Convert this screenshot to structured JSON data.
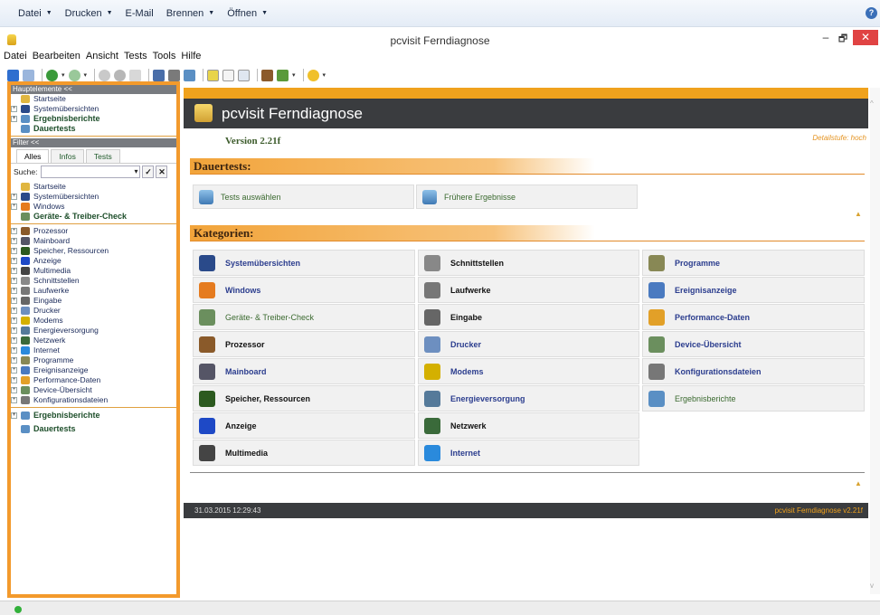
{
  "explorer_bar": {
    "items": [
      {
        "label": "Datei",
        "has_dropdown": true
      },
      {
        "label": "Drucken",
        "has_dropdown": true
      },
      {
        "label": "E-Mail",
        "has_dropdown": false
      },
      {
        "label": "Brennen",
        "has_dropdown": true
      },
      {
        "label": "Öffnen",
        "has_dropdown": true
      }
    ],
    "help_icon": "help-icon"
  },
  "window": {
    "title": "pcvisit Ferndiagnose",
    "min_glyph": "–",
    "max_glyph": "🗗",
    "close_glyph": "✕"
  },
  "menu": [
    "Datei",
    "Bearbeiten",
    "Ansicht",
    "Tests",
    "Tools",
    "Hilfe"
  ],
  "toolbar": {
    "caret": "▾"
  },
  "left": {
    "hauptelemente_header": "Hauptelemente <<",
    "haupt_items": [
      {
        "label": "Startseite",
        "expander": false,
        "bold": false,
        "icon": "computer-icon",
        "color": "#e0b640"
      },
      {
        "label": "Systemübersichten",
        "expander": true,
        "bold": false,
        "icon": "eye-icon",
        "color": "#2a4a8a"
      },
      {
        "label": "Ergebnisberichte",
        "expander": true,
        "bold": true,
        "icon": "report-icon",
        "color": "#5a8fc4"
      },
      {
        "label": "Dauertests",
        "expander": false,
        "bold": true,
        "icon": "report-icon",
        "color": "#5a8fc4"
      }
    ],
    "filter_header": "Filter <<",
    "filter_tabs": [
      "Alles",
      "Infos",
      "Tests"
    ],
    "search_label": "Suche:",
    "search_value": "",
    "search_dropdown": "▾",
    "search_apply": "✓",
    "search_clear": "✕",
    "tree_top": [
      {
        "label": "Startseite",
        "expander": false,
        "bold": false,
        "icon": "computer-icon",
        "color": "#e0b640"
      },
      {
        "label": "Systemübersichten",
        "expander": true,
        "bold": false,
        "icon": "eye-icon",
        "color": "#2a4a8a"
      },
      {
        "label": "Windows",
        "expander": true,
        "bold": false,
        "icon": "windows-icon",
        "color": "#e57b1f"
      },
      {
        "label": "Geräte- & Treiber-Check",
        "expander": false,
        "bold": true,
        "icon": "device-check-icon",
        "color": "#6b8f5e"
      }
    ],
    "tree_main": [
      {
        "label": "Prozessor",
        "icon": "processor-icon",
        "color": "#8a5a2a"
      },
      {
        "label": "Mainboard",
        "icon": "mainboard-icon",
        "color": "#556"
      },
      {
        "label": "Speicher, Ressourcen",
        "icon": "memory-icon",
        "color": "#2c5a1f"
      },
      {
        "label": "Anzeige",
        "icon": "monitor-icon",
        "color": "#1e49c6"
      },
      {
        "label": "Multimedia",
        "icon": "multimedia-icon",
        "color": "#444"
      },
      {
        "label": "Schnittstellen",
        "icon": "interface-icon",
        "color": "#888"
      },
      {
        "label": "Laufwerke",
        "icon": "drive-icon",
        "color": "#777"
      },
      {
        "label": "Eingabe",
        "icon": "keyboard-icon",
        "color": "#666"
      },
      {
        "label": "Drucker",
        "icon": "printer-icon",
        "color": "#6d8fc0"
      },
      {
        "label": "Modems",
        "icon": "modem-icon",
        "color": "#d4b000"
      },
      {
        "label": "Energieversorgung",
        "icon": "power-icon",
        "color": "#557a9a"
      },
      {
        "label": "Netzwerk",
        "icon": "network-icon",
        "color": "#3a6a3a"
      },
      {
        "label": "Internet",
        "icon": "internet-icon",
        "color": "#2a8adc"
      },
      {
        "label": "Programme",
        "icon": "programs-icon",
        "color": "#885"
      },
      {
        "label": "Ereignisanzeige",
        "icon": "event-viewer-icon",
        "color": "#4a7ac0"
      },
      {
        "label": "Performance-Daten",
        "icon": "performance-icon",
        "color": "#e2a028"
      },
      {
        "label": "Device-Übersicht",
        "icon": "device-overview-icon",
        "color": "#6b8f5e"
      },
      {
        "label": "Konfigurationsdateien",
        "icon": "config-files-icon",
        "color": "#777"
      }
    ],
    "tree_bottom": [
      {
        "label": "Ergebnisberichte",
        "expander": true,
        "bold": true,
        "icon": "report-icon",
        "color": "#5a8fc4"
      },
      {
        "label": "Dauertests",
        "expander": false,
        "bold": true,
        "icon": "report-icon",
        "color": "#5a8fc4"
      }
    ]
  },
  "main": {
    "title": "pcvisit Ferndiagnose",
    "version": "Version 2.21f",
    "detail": "Detailstufe: hoch",
    "dauertests_heading": "Dauertests:",
    "dauertests_tiles": [
      "Tests auswählen",
      "Frühere Ergebnisse"
    ],
    "kategorien_heading": "Kategorien:",
    "categories": [
      [
        {
          "label": "Systemübersichten",
          "style": "blue",
          "icon": "eye-icon",
          "color": "#2a4a8a"
        },
        {
          "label": "Schnittstellen",
          "style": "black",
          "icon": "interface-icon",
          "color": "#888"
        },
        {
          "label": "Programme",
          "style": "blue",
          "icon": "programs-icon",
          "color": "#885"
        }
      ],
      [
        {
          "label": "Windows",
          "style": "blue",
          "icon": "windows-icon",
          "color": "#e57b1f"
        },
        {
          "label": "Laufwerke",
          "style": "black",
          "icon": "drive-icon",
          "color": "#777"
        },
        {
          "label": "Ereignisanzeige",
          "style": "blue",
          "icon": "event-viewer-icon",
          "color": "#4a7ac0"
        }
      ],
      [
        {
          "label": "Geräte- & Treiber-Check",
          "style": "green",
          "icon": "device-check-icon",
          "color": "#6b8f5e"
        },
        {
          "label": "Eingabe",
          "style": "black",
          "icon": "keyboard-icon",
          "color": "#666"
        },
        {
          "label": "Performance-Daten",
          "style": "blue",
          "icon": "performance-icon",
          "color": "#e2a028"
        }
      ],
      [
        {
          "label": "Prozessor",
          "style": "black",
          "icon": "processor-icon",
          "color": "#8a5a2a"
        },
        {
          "label": "Drucker",
          "style": "blue",
          "icon": "printer-icon",
          "color": "#6d8fc0"
        },
        {
          "label": "Device-Übersicht",
          "style": "blue",
          "icon": "device-overview-icon",
          "color": "#6b8f5e"
        }
      ],
      [
        {
          "label": "Mainboard",
          "style": "blue",
          "icon": "mainboard-icon",
          "color": "#556"
        },
        {
          "label": "Modems",
          "style": "blue",
          "icon": "modem-icon",
          "color": "#d4b000"
        },
        {
          "label": "Konfigurationsdateien",
          "style": "blue",
          "icon": "config-files-icon",
          "color": "#777"
        }
      ],
      [
        {
          "label": "Speicher, Ressourcen",
          "style": "black",
          "icon": "memory-icon",
          "color": "#2c5a1f"
        },
        {
          "label": "Energieversorgung",
          "style": "blue",
          "icon": "power-icon",
          "color": "#557a9a"
        },
        {
          "label": "Ergebnisberichte",
          "style": "green",
          "icon": "report-icon",
          "color": "#5a8fc4"
        }
      ],
      [
        {
          "label": "Anzeige",
          "style": "black",
          "icon": "monitor-icon",
          "color": "#1e49c6"
        },
        {
          "label": "Netzwerk",
          "style": "black",
          "icon": "network-icon",
          "color": "#3a6a3a"
        }
      ],
      [
        {
          "label": "Multimedia",
          "style": "black",
          "icon": "multimedia-icon",
          "color": "#444"
        },
        {
          "label": "Internet",
          "style": "blue",
          "icon": "internet-icon",
          "color": "#2a8adc"
        }
      ]
    ],
    "footer_left": "31.03.2015 12:29:43",
    "footer_right": "pcvisit Ferndiagnose v2.21f"
  },
  "colors": {
    "accent_orange": "#f39a2c",
    "banner_dark": "#3a3c3f"
  }
}
